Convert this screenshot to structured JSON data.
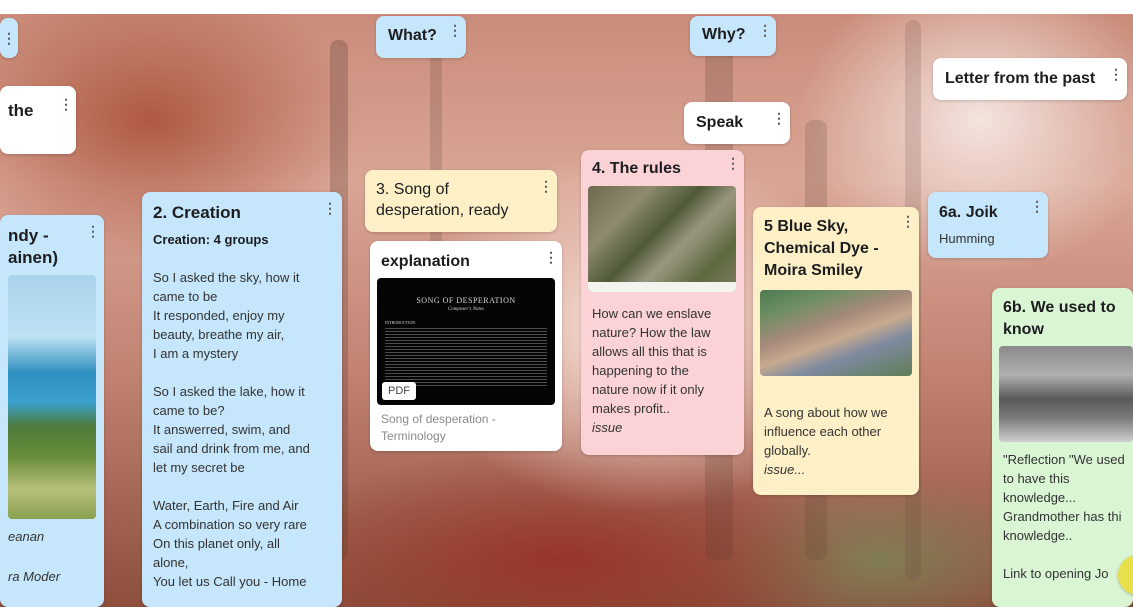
{
  "cards": {
    "left_top": {
      "label": ""
    },
    "the": {
      "label": "the"
    },
    "left_mid": {
      "line1": "ndy -",
      "line2": "ainen)",
      "line3": "eanan",
      "line4": "ra Moder"
    },
    "what": {
      "label": "What?"
    },
    "why": {
      "label": "Why?"
    },
    "speak": {
      "label": "Speak"
    },
    "letter": {
      "label": "Letter from the past"
    },
    "creation": {
      "title": "2. Creation",
      "subtitle": "Creation: 4 groups",
      "lines": [
        "So I asked the sky, how it",
        "came to be",
        "It responded, enjoy my",
        "beauty, breathe my air,",
        "I am a mystery",
        "",
        "So I asked the lake, how it",
        "came to be?",
        "It answerred, swim, and",
        "sail and drink from me, and",
        "let my secret be",
        "",
        "Water, Earth, Fire and Air",
        "A combination so very rare",
        "On this planet only, all",
        "alone,",
        "You let us Call you - Home"
      ]
    },
    "song": {
      "line1": "3. Song of",
      "line2": "desperation, ready"
    },
    "explanation": {
      "title": "explanation",
      "pdf_title": "SONG OF DESPERATION",
      "pdf_subtitle": "Composer's Notes",
      "pdf_heading": "INTRODUCTION",
      "pdf_badge": "PDF",
      "caption1": "Song of desperation -",
      "caption2": "Terminology"
    },
    "rules": {
      "title": "4. The rules",
      "lines": [
        "How can we enslave",
        "nature? How the law",
        "allows all this that is",
        "happening to the",
        "nature now if it only",
        "makes profit.."
      ],
      "tag": "issue"
    },
    "bluesky": {
      "line1": "5  Blue Sky,",
      "line2": "Chemical Dye -",
      "line3": "Moira Smiley",
      "lines": [
        "A song about how we",
        "influence each other",
        "globally."
      ],
      "tag": "issue..."
    },
    "joik": {
      "title": "6a. Joik",
      "subtitle": "Humming"
    },
    "weused": {
      "line1": "6b. We used to",
      "line2": "know",
      "lines": [
        "\"Reflection \"We used",
        "to have this",
        "knowledge...",
        "Grandmother has thi",
        "knowledge..",
        "",
        "Link to opening Jo"
      ]
    }
  },
  "colors": {
    "blue_card": "#c5e6fb",
    "yellow_card": "#fdf0c6",
    "pink_card": "#fbd2d5",
    "green_card": "#d9f5d4",
    "white_card": "#ffffff"
  },
  "icons": {
    "menu": "more-vertical-icon"
  }
}
